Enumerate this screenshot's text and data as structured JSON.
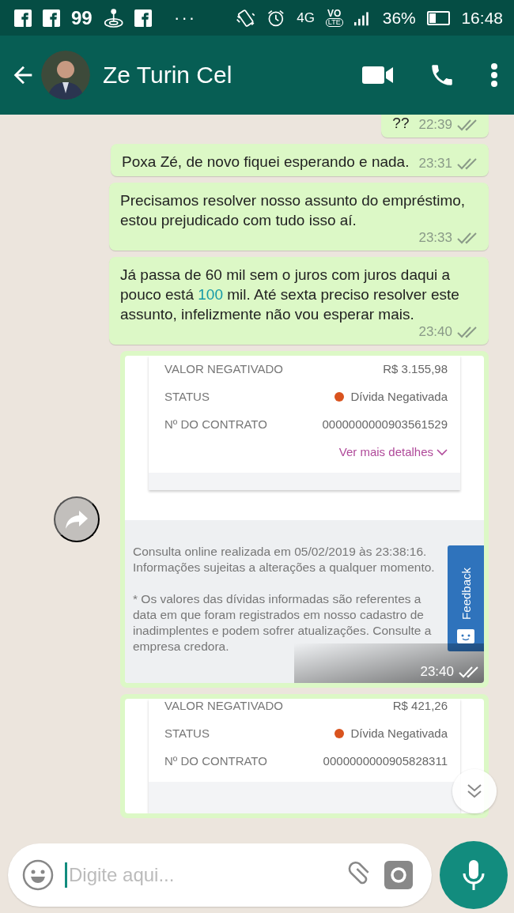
{
  "status_bar": {
    "apps": [
      {
        "kind": "facebook"
      },
      {
        "kind": "facebook"
      },
      {
        "kind": "text",
        "text": "99"
      },
      {
        "kind": "joystick"
      },
      {
        "kind": "facebook"
      },
      {
        "kind": "text",
        "text": "···"
      }
    ],
    "network": "4G",
    "volte_top": "VO",
    "volte_bottom": "LTE",
    "battery": "36%",
    "time": "16:48"
  },
  "header": {
    "contact": "Ze Turin Cel"
  },
  "messages": [
    {
      "kind": "text",
      "parts": [
        {
          "kind": "plain",
          "text": "??"
        }
      ],
      "time": "22:39",
      "read": true,
      "cut_top": true
    },
    {
      "kind": "text",
      "parts": [
        {
          "kind": "plain",
          "text": "Poxa Zé, de novo fiquei esperando e nada."
        }
      ],
      "time": "23:31",
      "read": true
    },
    {
      "kind": "text",
      "parts": [
        {
          "kind": "plain",
          "text": "Precisamos resolver nosso assunto do empréstimo, estou prejudicado com tudo isso aí."
        }
      ],
      "time": "23:33",
      "read": true
    },
    {
      "kind": "text",
      "parts": [
        {
          "kind": "plain",
          "text": "Já passa de 60 mil sem o juros com juros daqui a pouco está "
        },
        {
          "kind": "link",
          "text": "100"
        },
        {
          "kind": "plain",
          "text": " mil. Até sexta preciso resolver este assunto, infelizmente não vou esperar mais."
        }
      ],
      "time": "23:40",
      "read": true
    },
    {
      "kind": "screenshot",
      "forward": true,
      "rows": [
        {
          "label": "VALOR NEGATIVADO",
          "value": "R$ 3.155,98"
        },
        {
          "label": "STATUS",
          "value": "Dívida Negativada",
          "color": "#d9531e"
        },
        {
          "label": "Nº DO CONTRATO",
          "value": "0000000000903561529"
        }
      ],
      "link": "Ver mais detalhes",
      "notes": [
        "Consulta online realizada em 05/02/2019 às 23:38:16. Informações sujeitas a alterações a qualquer momento.",
        "* Os valores das dívidas informadas são referentes a data em que foram registrados em nosso cadastro de inadimplentes e podem sofrer atualizações. Consulte a empresa credora."
      ],
      "feedback": "Feedback",
      "time": "23:40",
      "read": true
    },
    {
      "kind": "screenshot",
      "rows": [
        {
          "label": "VALOR NEGATIVADO",
          "value": "R$ 421,26"
        },
        {
          "label": "STATUS",
          "value": "Dívida Negativada",
          "color": "#d9531e"
        },
        {
          "label": "Nº DO CONTRATO",
          "value": "0000000000905828311"
        }
      ]
    }
  ],
  "composer": {
    "placeholder": "Digite aqui..."
  }
}
